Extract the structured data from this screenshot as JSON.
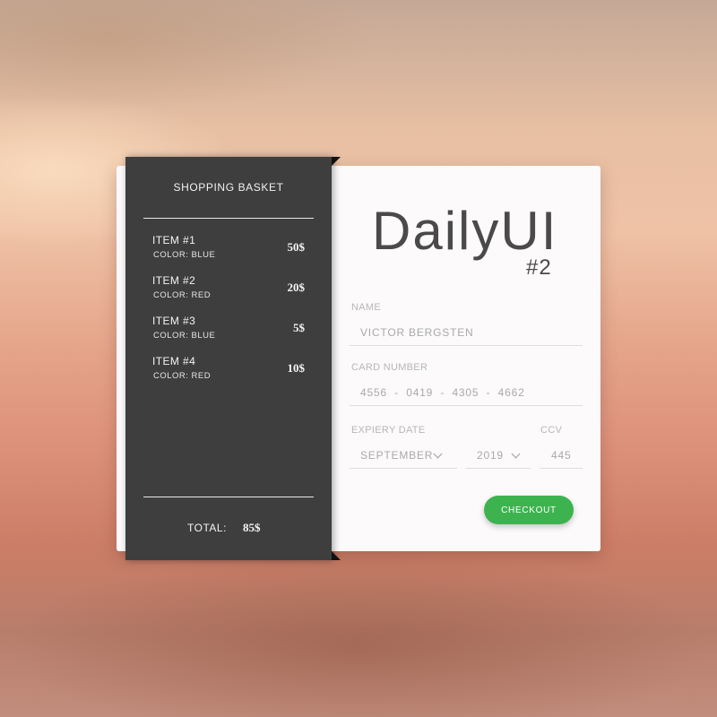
{
  "basket": {
    "title": "SHOPPING BASKET",
    "items": [
      {
        "name": "ITEM #1",
        "color": "COLOR: BLUE",
        "price": "50$"
      },
      {
        "name": "ITEM #2",
        "color": "COLOR: RED",
        "price": "20$"
      },
      {
        "name": "ITEM #3",
        "color": "COLOR: BLUE",
        "price": "5$"
      },
      {
        "name": "ITEM #4",
        "color": "COLOR: RED",
        "price": "10$"
      }
    ],
    "total_label": "TOTAL:",
    "total_value": "85$"
  },
  "brand": {
    "title": "DailyUI",
    "subtitle": "#2"
  },
  "form": {
    "name_label": "NAME",
    "name_value": "VICTOR BERGSTEN",
    "card_label": "CARD NUMBER",
    "card_value": "4556  -  0419  -  4305  -  4662",
    "expiry_label": "EXPIERY DATE",
    "expiry_month": "SEPTEMBER",
    "expiry_year": "2019",
    "ccv_label": "CCV",
    "ccv_value": "445",
    "checkout_label": "CHECKOUT"
  },
  "colors": {
    "basket_bg": "#3e3e3e",
    "card_bg": "#fcfafb",
    "accent": "#3db34f",
    "text_dark": "#4a4a4a"
  },
  "icons": {
    "month_dropdown": "chevron-down-icon",
    "year_dropdown": "chevron-down-icon"
  }
}
